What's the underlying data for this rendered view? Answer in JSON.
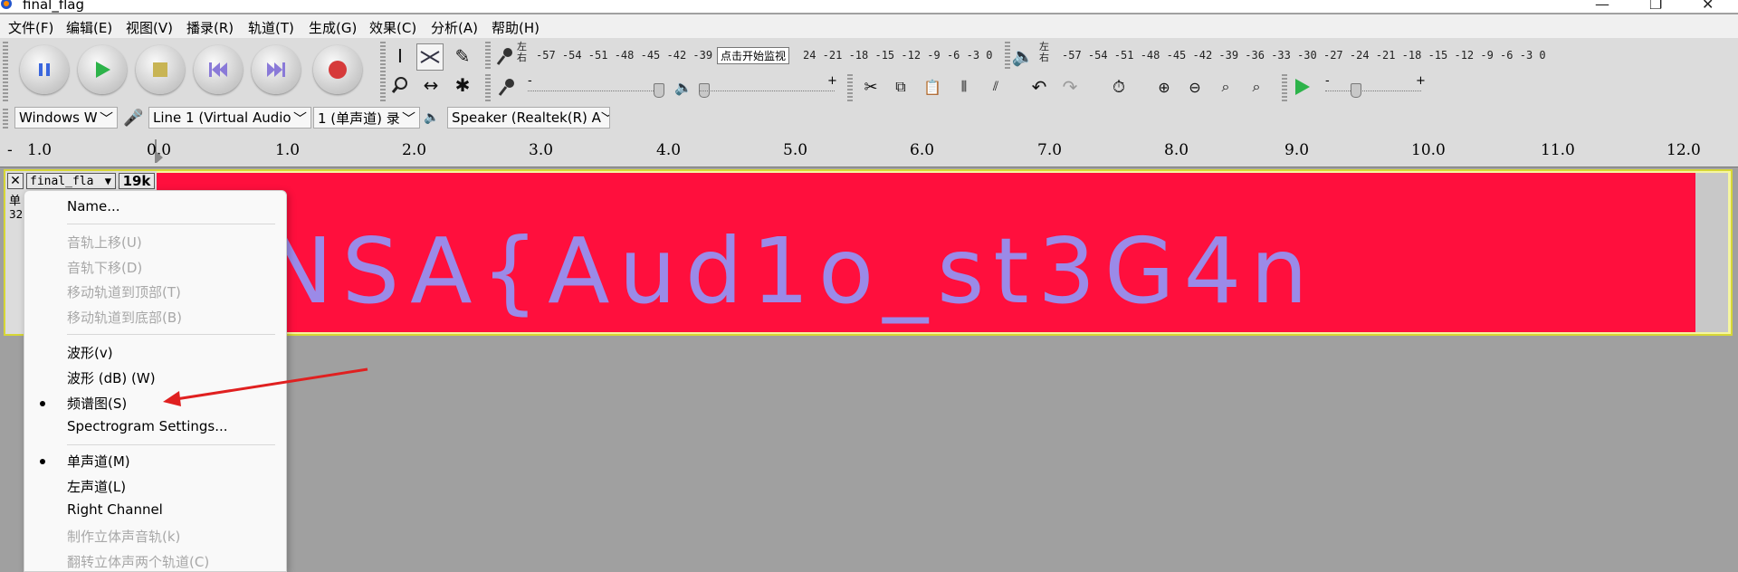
{
  "window": {
    "title": "final_flag"
  },
  "menubar": [
    "文件(F)",
    "编辑(E)",
    "视图(V)",
    "播录(R)",
    "轨道(T)",
    "生成(G)",
    "效果(C)",
    "分析(A)",
    "帮助(H)"
  ],
  "meters": {
    "record_scale": "-57 -54 -51 -48 -45 -42 -39 -",
    "record_button": "点击开始监视",
    "record_scale_right": "24 -21 -18 -15 -12  -9  -6  -3  0",
    "play_scale": "-57 -54 -51 -48 -45 -42 -39 -36 -33 -30 -27 -24 -21 -18 -15 -12  -9  -6  -3  0",
    "lr_label_top": "左",
    "lr_label_bottom": "右"
  },
  "sliders": {
    "minus": "-",
    "plus": "+"
  },
  "devices": {
    "host": "Windows W",
    "input": "Line 1 (Virtual Audio",
    "channels": "1 (单声道) 录",
    "output": "Speaker (Realtek(R) A"
  },
  "ruler": {
    "minus": "-",
    "ticks": [
      "1.0",
      "0.0",
      "1.0",
      "2.0",
      "3.0",
      "4.0",
      "5.0",
      "6.0",
      "7.0",
      "8.0",
      "9.0",
      "10.0",
      "11.0",
      "12.0"
    ]
  },
  "track": {
    "name": "final_fla",
    "rate_badge": "19k",
    "info_line1": "单",
    "info_line2": "32",
    "spectrogram_text": "NSA{Aud1o_st3G4n"
  },
  "context_menu": {
    "items": [
      {
        "label": "Name...",
        "enabled": true,
        "checked": false
      },
      {
        "label": "音轨上移(U)",
        "enabled": false,
        "checked": false
      },
      {
        "label": "音轨下移(D)",
        "enabled": false,
        "checked": false
      },
      {
        "label": "移动轨道到顶部(T)",
        "enabled": false,
        "checked": false
      },
      {
        "label": "移动轨道到底部(B)",
        "enabled": false,
        "checked": false
      },
      {
        "label": "波形(v)",
        "enabled": true,
        "checked": false
      },
      {
        "label": "波形 (dB) (W)",
        "enabled": true,
        "checked": false
      },
      {
        "label": "频谱图(S)",
        "enabled": true,
        "checked": true
      },
      {
        "label": "Spectrogram Settings...",
        "enabled": true,
        "checked": false
      },
      {
        "label": "单声道(M)",
        "enabled": true,
        "checked": true
      },
      {
        "label": "左声道(L)",
        "enabled": true,
        "checked": false
      },
      {
        "label": "Right Channel",
        "enabled": true,
        "checked": false
      },
      {
        "label": "制作立体声音轨(k)",
        "enabled": false,
        "checked": false
      },
      {
        "label": "翻转立体声两个轨道(C)",
        "enabled": false,
        "checked": false
      }
    ]
  },
  "colors": {
    "spectrogram_bg": "#ff0f3d",
    "spectrogram_text": "#9b8ae8",
    "annotation_arrow": "#e02020",
    "track_selected_border": "#d7d736"
  }
}
